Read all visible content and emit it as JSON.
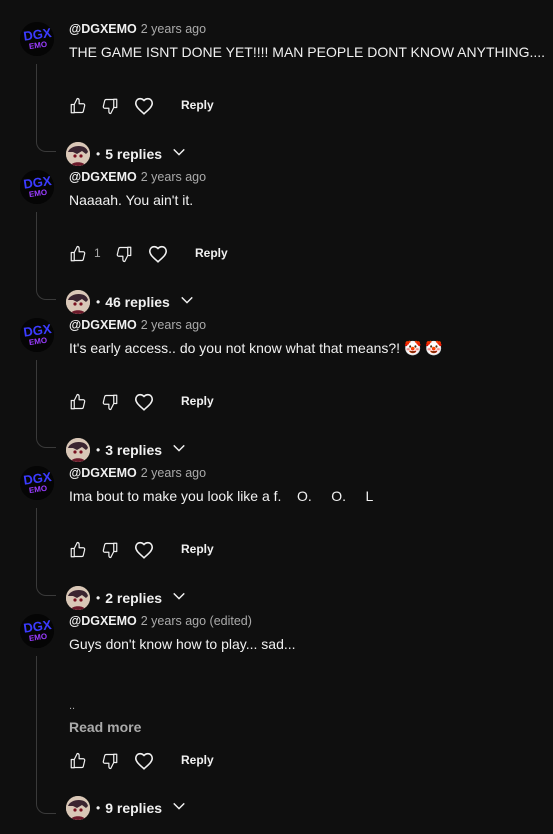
{
  "colors": {
    "background": "#0f0f0f",
    "text": "#f1f1f1",
    "muted": "#aaaaaa",
    "logo_primary": "#3b3bff",
    "logo_accent": "#9a3cff"
  },
  "avatar": {
    "logo_text_top": "DGX",
    "logo_text_bottom": "EMO"
  },
  "comments": [
    {
      "author": "@DGXEMO",
      "time": "2 years ago",
      "text": "THE GAME ISNT DONE YET!!!! MAN PEOPLE DONT KNOW ANYTHING....",
      "likes": "",
      "reply_label": "Reply",
      "replies_label": "5 replies"
    },
    {
      "author": "@DGXEMO",
      "time": "2 years ago",
      "text": "Naaaah. You ain't it.",
      "likes": "1",
      "reply_label": "Reply",
      "replies_label": "46 replies"
    },
    {
      "author": "@DGXEMO",
      "time": "2 years ago",
      "text": "It's early access.. do you not know what that means?! 🤡 🤡",
      "likes": "",
      "reply_label": "Reply",
      "replies_label": "3 replies"
    },
    {
      "author": "@DGXEMO",
      "time": "2 years ago",
      "text": "Ima bout to make you look like a f.    O.     O.     L",
      "likes": "",
      "reply_label": "Reply",
      "replies_label": "2 replies"
    },
    {
      "author": "@DGXEMO",
      "time": "2 years ago (edited)",
      "text": "Guys don't know how to play... sad...",
      "extra": "..",
      "read_more": "Read more",
      "likes": "",
      "reply_label": "Reply",
      "replies_label": "9 replies"
    }
  ]
}
